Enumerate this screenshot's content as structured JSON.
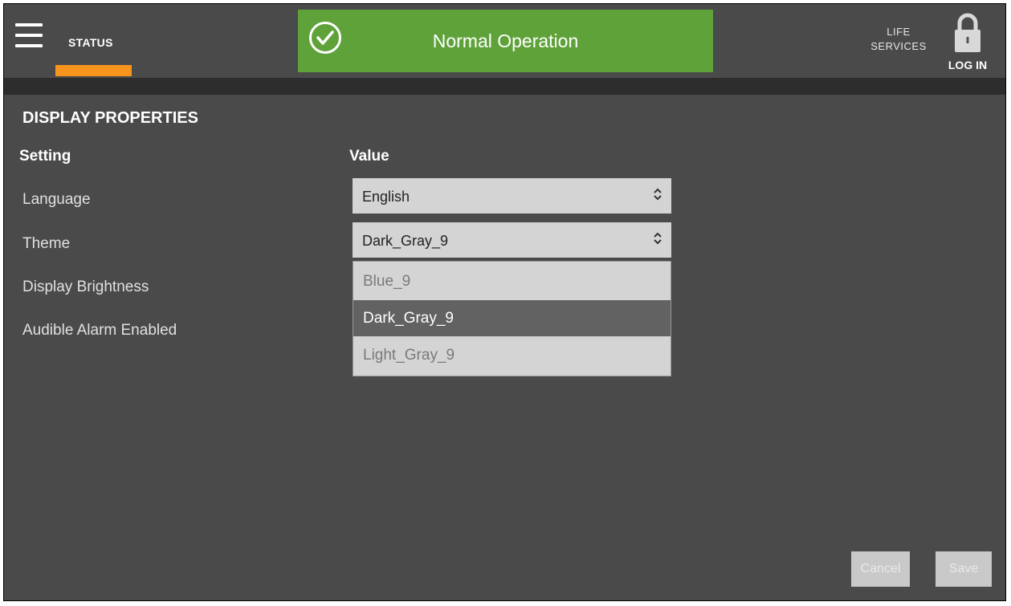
{
  "header": {
    "status_tab": "STATUS",
    "banner_text": "Normal Operation",
    "life_services_line1": "LIFE",
    "life_services_line2": "SERVICES",
    "login_label": "LOG IN"
  },
  "colors": {
    "banner_green": "#5fa23a",
    "status_underline": "#f7941d",
    "background": "#4a4a4a"
  },
  "page": {
    "title": "DISPLAY PROPERTIES",
    "col_setting": "Setting",
    "col_value": "Value",
    "settings": [
      "Language",
      "Theme",
      "Display Brightness",
      "Audible Alarm Enabled"
    ],
    "language_value": "English",
    "theme_value": "Dark_Gray_9",
    "theme_options": [
      "Blue_9",
      "Dark_Gray_9",
      "Light_Gray_9"
    ],
    "theme_selected_option": "Dark_Gray_9"
  },
  "footer": {
    "cancel_label": "Cancel",
    "save_label": "Save"
  },
  "icons": [
    "menu-icon",
    "check-circle-icon",
    "lock-icon",
    "select-arrows-icon"
  ]
}
